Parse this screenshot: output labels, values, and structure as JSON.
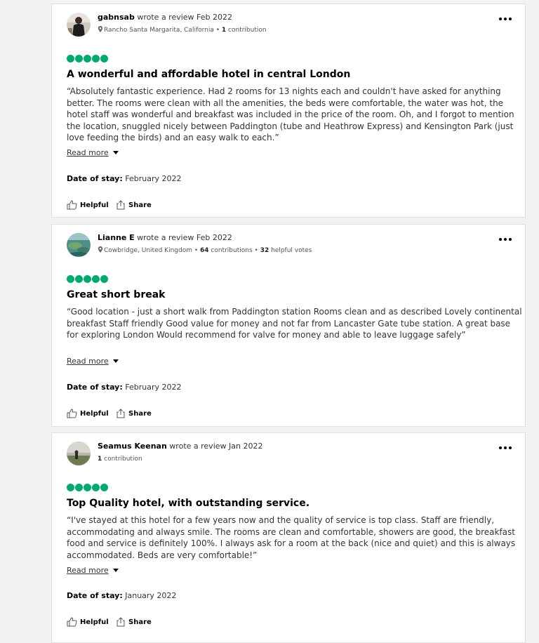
{
  "reviews": [
    {
      "name": "gabnsab",
      "action": " wrote a review Feb 2022",
      "location": "Rancho Santa Margarita, California",
      "sep1": " • ",
      "contributions_num": "1",
      "contributions_label": " contribution",
      "helpful_votes": "",
      "helpful_label": "",
      "rating": 5,
      "title": "A wonderful and affordable hotel in central London",
      "body": "“Absolutely fantastic experience. Had 2 rooms for 13 nights each and couldn't have asked for anything better. The rooms were clean with all the amenities, the beds were comfortable, the water was hot, the hotel staff was wonderful and breakfast was included in the price of the room. Oh, and I forgot to mention the location, snuggled nicely between Paddington (tube and Heathrow Express) and Kensington Park (just love feeding the birds) and an easy walk to each.”",
      "read_more": "Read more",
      "date_label": "Date of stay:",
      "date_value": " February 2022",
      "helpful": "Helpful",
      "share": "Share"
    },
    {
      "name": "Lianne E",
      "action": " wrote a review Feb 2022",
      "location": "Cowbridge, United Kingdom",
      "sep1": " • ",
      "contributions_num": "64",
      "contributions_label": " contributions",
      "sep2": " • ",
      "helpful_votes": "32",
      "helpful_label": " helpful votes",
      "rating": 5,
      "title": "Great short break",
      "body": "“Good location - just a short walk from Paddington station Rooms clean and as described Lovely continental breakfast Staff friendly Good value for money and not far from Lancaster Gate tube station. A great base for exploring London Would recommend for valve for money and able to leave luggage safely”",
      "read_more": "Read more",
      "date_label": "Date of stay:",
      "date_value": " February 2022",
      "helpful": "Helpful",
      "share": "Share"
    },
    {
      "name": "Seamus Keenan",
      "action": " wrote a review Jan 2022",
      "contributions_num": "1",
      "contributions_label": " contribution",
      "rating": 5,
      "title": "Top Quality hotel, with outstanding service.",
      "body": "“I've stayed at this hotel for a few years now and the quality of service is top class. Staff are friendly, accommodating and always smile. The rooms are clean and comfortable, showers are good, the breakfast food and service is definitely 100%. I always ask for a room at the back (nice and quiet) and this is always accommodated. Beds are very comfortable!”",
      "read_more": "Read more",
      "date_label": "Date of stay:",
      "date_value": " January 2022",
      "helpful": "Helpful",
      "share": "Share"
    }
  ],
  "colors": {
    "bubble_green": "#00aa6c",
    "page_bg": "#f2f2f2",
    "card_border": "#e0e0e0"
  },
  "icons": {
    "more": "more-options-icon",
    "location": "location-pin-icon",
    "helpful": "thumbs-up-icon",
    "share": "share-icon"
  }
}
